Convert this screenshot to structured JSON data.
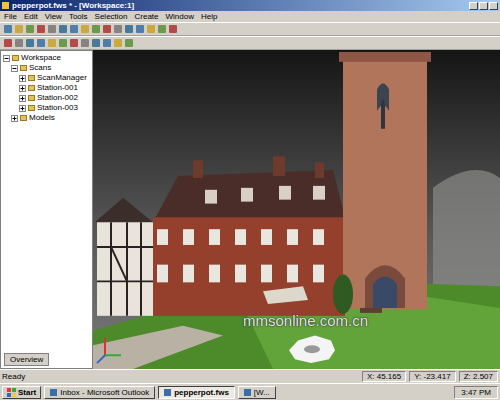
{
  "window": {
    "title": "pepperpot.fws * - [Workspace:1]"
  },
  "menu": [
    "File",
    "Edit",
    "View",
    "Tools",
    "Selection",
    "Create",
    "Window",
    "Help"
  ],
  "tree": [
    {
      "label": "Workspace",
      "expanded": true,
      "children": [
        {
          "label": "Scans",
          "expanded": true,
          "children": [
            {
              "label": "ScanManager",
              "expanded": false,
              "children": []
            },
            {
              "label": "Station-001",
              "expanded": false,
              "children": []
            },
            {
              "label": "Station-002",
              "expanded": false,
              "children": []
            },
            {
              "label": "Station-003",
              "expanded": false,
              "children": []
            }
          ]
        },
        {
          "label": "Models",
          "expanded": false,
          "children": []
        }
      ]
    }
  ],
  "panel_tab": "Overview",
  "watermark": "mmsonline.com.cn",
  "status_bar": {
    "message": "Ready",
    "fields": [
      "X: 45.165",
      "Y: -23.417",
      "Z: 2.507"
    ]
  },
  "taskbar": {
    "start": "Start",
    "items": [
      {
        "label": "Inbox - Microsoft Outlook",
        "selected": false
      },
      {
        "label": "pepperpot.fws",
        "selected": true
      },
      {
        "label": "[W...",
        "selected": false
      }
    ],
    "clock": "3:47 PM"
  }
}
